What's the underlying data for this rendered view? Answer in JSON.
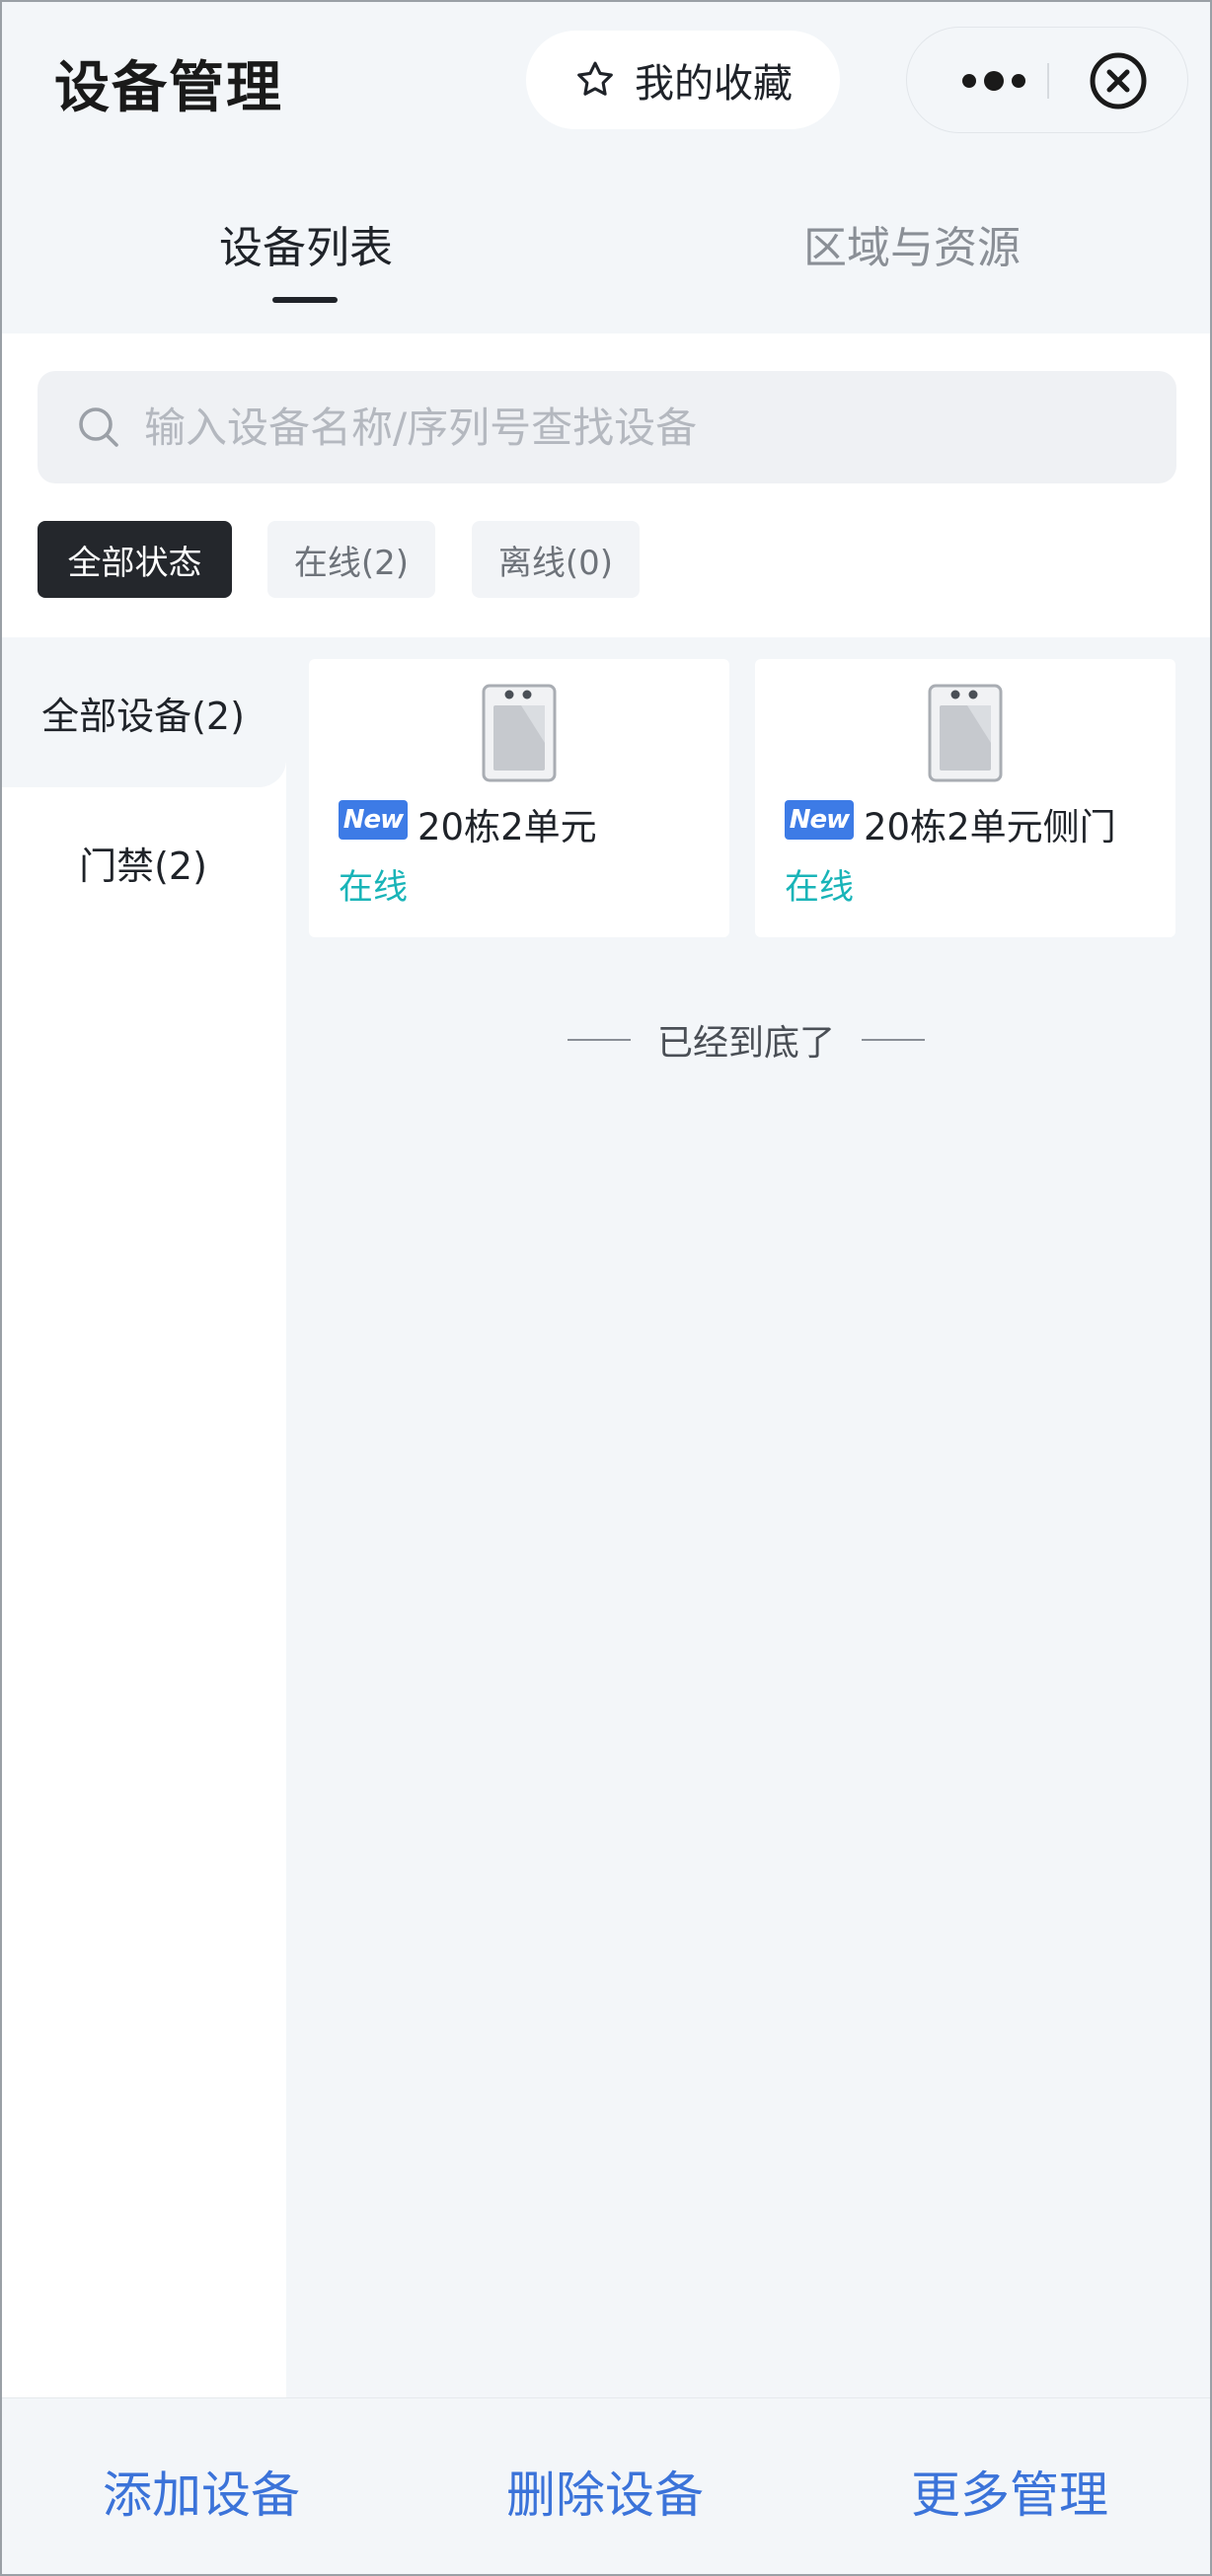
{
  "header": {
    "title": "设备管理",
    "favorites_label": "我的收藏",
    "icons": {
      "favorites": "star-outline-icon",
      "more": "more-dots-icon",
      "close": "close-circle-icon"
    }
  },
  "tabs": [
    {
      "label": "设备列表",
      "active": true
    },
    {
      "label": "区域与资源",
      "active": false
    }
  ],
  "search": {
    "placeholder": "输入设备名称/序列号查找设备",
    "value": "",
    "icon": "search-icon"
  },
  "filters": [
    {
      "label": "全部状态",
      "selected": true
    },
    {
      "label": "在线(2)",
      "selected": false
    },
    {
      "label": "离线(0)",
      "selected": false
    }
  ],
  "sidebar": {
    "items": [
      {
        "label": "全部设备(2)",
        "active": true
      },
      {
        "label": "门禁(2)",
        "active": false
      }
    ]
  },
  "devices": [
    {
      "badge": "New",
      "name": "20栋2单元",
      "status": "在线",
      "icon": "access-control-device-icon"
    },
    {
      "badge": "New",
      "name": "20栋2单元侧门",
      "status": "在线",
      "icon": "access-control-device-icon"
    }
  ],
  "list_end_text": "已经到底了",
  "toolbar": {
    "add_label": "添加设备",
    "delete_label": "删除设备",
    "more_label": "更多管理"
  },
  "colors": {
    "accent": "#3b73d9",
    "online": "#19b4b8",
    "badge": "#3d7be6",
    "chip_active": "#24272c",
    "background": "#f3f6f9"
  }
}
